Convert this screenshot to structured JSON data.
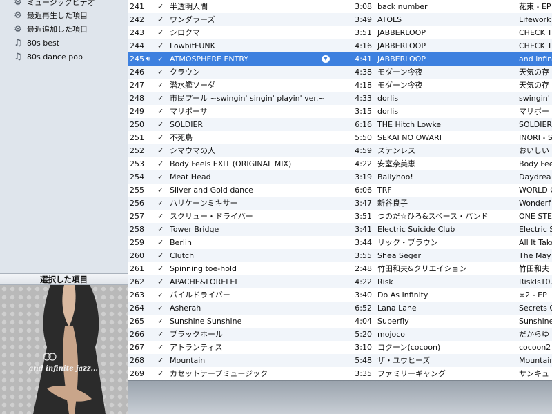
{
  "sidebar": {
    "items": [
      {
        "icon": "gear-icon",
        "label": "ミュージックビデオ"
      },
      {
        "icon": "gear-icon",
        "label": "最近再生した項目"
      },
      {
        "icon": "gear-icon",
        "label": "最近追加した項目"
      },
      {
        "icon": "playlist-icon",
        "label": "80s best"
      },
      {
        "icon": "playlist-icon",
        "label": "80s dance pop"
      }
    ],
    "artwork_title": "選択した項目",
    "artwork_text": "and infinite jazz..."
  },
  "tracks": [
    {
      "num": "241",
      "check": "✓",
      "name": "半透明人間",
      "time": "3:08",
      "artist": "back number",
      "album": "花束 - EP"
    },
    {
      "num": "242",
      "check": "✓",
      "name": "ワンダラーズ",
      "time": "3:49",
      "artist": "ATOLS",
      "album": "Lifework"
    },
    {
      "num": "243",
      "check": "✓",
      "name": "シロクマ",
      "time": "3:51",
      "artist": "JABBERLOOP",
      "album": "CHECK TH"
    },
    {
      "num": "244",
      "check": "✓",
      "name": "LowbitFUNK",
      "time": "4:16",
      "artist": "JABBERLOOP",
      "album": "CHECK TH"
    },
    {
      "num": "245",
      "check": "✓",
      "name": "ATMOSPHERE ENTRY",
      "time": "4:41",
      "artist": "JABBERLOOP",
      "album": "and infin",
      "selected": true,
      "playing": true
    },
    {
      "num": "246",
      "check": "✓",
      "name": "クラウン",
      "time": "4:38",
      "artist": "モダーン今夜",
      "album": "天気の存"
    },
    {
      "num": "247",
      "check": "✓",
      "name": "潜水艦ソーダ",
      "time": "4:18",
      "artist": "モダーン今夜",
      "album": "天気の存"
    },
    {
      "num": "248",
      "check": "✓",
      "name": "市民プール ~swingin' singin' playin' ver.~",
      "time": "4:33",
      "artist": "dorlis",
      "album": "swingin'"
    },
    {
      "num": "249",
      "check": "✓",
      "name": "マリポーサ",
      "time": "3:15",
      "artist": "dorlis",
      "album": "マリポー"
    },
    {
      "num": "250",
      "check": "✓",
      "name": "SOLDIER",
      "time": "6:16",
      "artist": "THE Hitch Lowke",
      "album": "SOLDIER"
    },
    {
      "num": "251",
      "check": "✓",
      "name": "不死鳥",
      "time": "5:50",
      "artist": "SEKAI NO OWARI",
      "album": "INORI - Si"
    },
    {
      "num": "252",
      "check": "✓",
      "name": "シマウマの人",
      "time": "4:59",
      "artist": "ステンレス",
      "album": "おいしい"
    },
    {
      "num": "253",
      "check": "✓",
      "name": "Body Feels EXIT (ORIGINAL MIX)",
      "time": "4:22",
      "artist": "安室奈美恵",
      "album": "Body Fee"
    },
    {
      "num": "254",
      "check": "✓",
      "name": "Meat Head",
      "time": "3:19",
      "artist": "Ballyhoo!",
      "album": "Daydrea"
    },
    {
      "num": "255",
      "check": "✓",
      "name": "Silver and Gold dance",
      "time": "6:06",
      "artist": "TRF",
      "album": "WORLD G"
    },
    {
      "num": "256",
      "check": "✓",
      "name": "ハリケーンミキサー",
      "time": "3:47",
      "artist": "新谷良子",
      "album": "Wonderf"
    },
    {
      "num": "257",
      "check": "✓",
      "name": "スクリュー・ドライバー",
      "time": "3:51",
      "artist": "つのだ☆ひろ&スペース・バンド",
      "album": "ONE STEP"
    },
    {
      "num": "258",
      "check": "✓",
      "name": "Tower Bridge",
      "time": "3:41",
      "artist": "Electric Suicide Club",
      "album": "Electric Su"
    },
    {
      "num": "259",
      "check": "✓",
      "name": "Berlin",
      "time": "3:44",
      "artist": "リック・ブラウン",
      "album": "All It Take"
    },
    {
      "num": "260",
      "check": "✓",
      "name": "Clutch",
      "time": "3:55",
      "artist": "Shea Seger",
      "album": "The May S"
    },
    {
      "num": "261",
      "check": "✓",
      "name": "Spinning toe-hold",
      "time": "2:48",
      "artist": "竹田和夫&クリエイション",
      "album": "竹田和夫"
    },
    {
      "num": "262",
      "check": "✓",
      "name": "APACHE&LORELEI",
      "time": "4:22",
      "artist": "Risk",
      "album": "RiskIsT0.5"
    },
    {
      "num": "263",
      "check": "✓",
      "name": "パイルドライバー",
      "time": "3:40",
      "artist": "Do As Infinity",
      "album": "∞2 - EP"
    },
    {
      "num": "264",
      "check": "✓",
      "name": "Asherah",
      "time": "6:52",
      "artist": "Lana Lane",
      "album": "Secrets O"
    },
    {
      "num": "265",
      "check": "✓",
      "name": "Sunshine Sunshine",
      "time": "4:04",
      "artist": "Superfly",
      "album": "Sunshine"
    },
    {
      "num": "266",
      "check": "✓",
      "name": "ブラックホール",
      "time": "5:20",
      "artist": "mojoco",
      "album": "だからゆ"
    },
    {
      "num": "267",
      "check": "✓",
      "name": "アトランティス",
      "time": "3:10",
      "artist": "コクーン(cocoon)",
      "album": "cocoon2"
    },
    {
      "num": "268",
      "check": "✓",
      "name": "Mountain",
      "time": "5:48",
      "artist": "ザ・ユウヒーズ",
      "album": "Mountain"
    },
    {
      "num": "269",
      "check": "✓",
      "name": "カセットテープミュージック",
      "time": "3:35",
      "artist": "ファミリーギャング",
      "album": "サンキュ"
    }
  ],
  "colors": {
    "selected_row": "#3d80df",
    "alt_row": "#f1f5fa",
    "sidebar_bg": "#dfe5ec"
  }
}
